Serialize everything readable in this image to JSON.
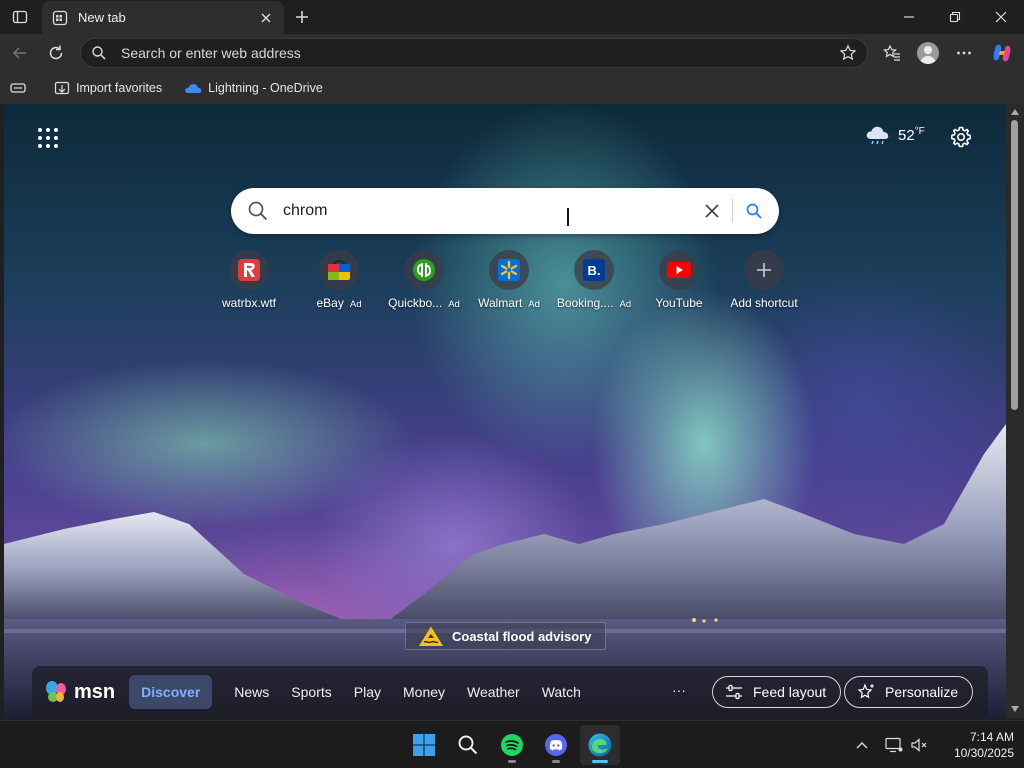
{
  "tab": {
    "title": "New tab"
  },
  "address_bar": {
    "placeholder": "Search or enter web address"
  },
  "favorites_bar": {
    "items": [
      {
        "label": "Import favorites"
      },
      {
        "label": "Lightning - OneDrive"
      }
    ]
  },
  "weather": {
    "temp": "52",
    "unit": "°F"
  },
  "search": {
    "query": "chrom"
  },
  "shortcuts": [
    {
      "label": "watrbx.wtf",
      "ad": "",
      "icon": "roblox-icon"
    },
    {
      "label": "eBay",
      "ad": "Ad",
      "icon": "ebay-icon"
    },
    {
      "label": "Quickbo...",
      "ad": "Ad",
      "icon": "quickbooks-icon"
    },
    {
      "label": "Walmart",
      "ad": "Ad",
      "icon": "walmart-icon"
    },
    {
      "label": "Booking....",
      "ad": "Ad",
      "icon": "booking-icon"
    },
    {
      "label": "YouTube",
      "ad": "",
      "icon": "youtube-icon"
    },
    {
      "label": "Add shortcut",
      "ad": "",
      "icon": "plus-icon"
    }
  ],
  "alert": {
    "label": "Coastal flood advisory"
  },
  "msn": {
    "logo": "msn",
    "tabs": [
      "Discover",
      "News",
      "Sports",
      "Play",
      "Money",
      "Weather",
      "Watch"
    ],
    "more": "···",
    "feed_layout": "Feed layout",
    "personalize": "Personalize"
  },
  "clock": {
    "time": "7:14 AM",
    "date": "10/30/2025"
  },
  "colors": {
    "accent": "#4cc2ff",
    "msn_active": "#7fb0ff"
  }
}
